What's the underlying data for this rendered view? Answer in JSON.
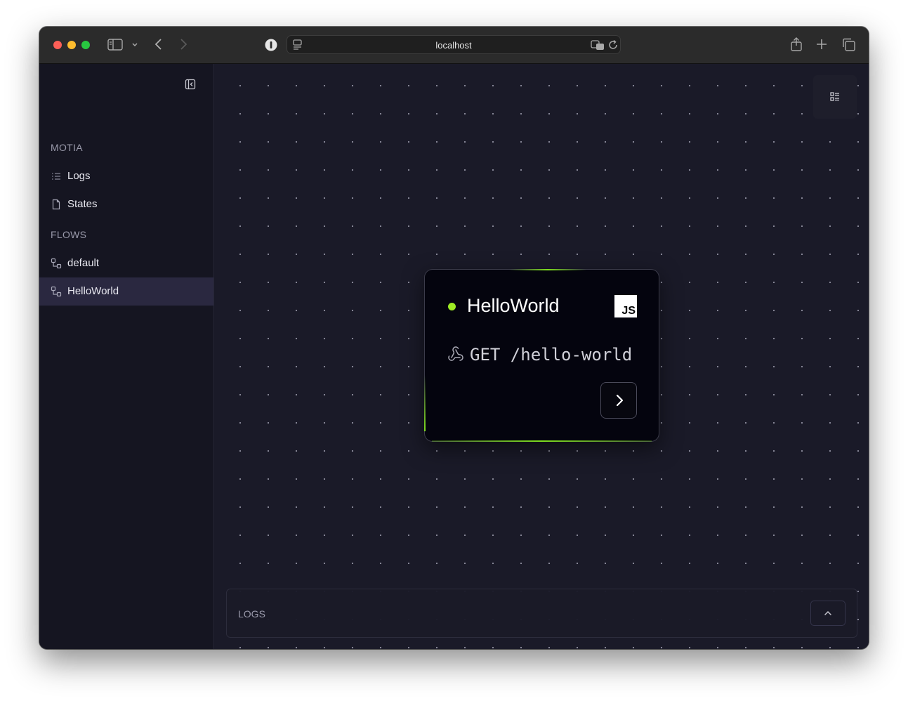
{
  "browser": {
    "url": "localhost"
  },
  "sidebar": {
    "sections": [
      {
        "title": "MOTIA",
        "items": [
          {
            "label": "Logs",
            "icon": "list-icon"
          },
          {
            "label": "States",
            "icon": "file-icon"
          }
        ]
      },
      {
        "title": "FLOWS",
        "items": [
          {
            "label": "default",
            "icon": "workflow-icon"
          },
          {
            "label": "HelloWorld",
            "icon": "workflow-icon",
            "active": true
          }
        ]
      }
    ]
  },
  "node": {
    "title": "HelloWorld",
    "language_badge": "JS",
    "method": "GET",
    "path": "/hello-world",
    "endpoint": "GET /hello-world",
    "status_color": "#9eeb24"
  },
  "logs_panel": {
    "title": "LOGS"
  },
  "colors": {
    "accent": "#7ddc1f",
    "background": "#1a1a28",
    "sidebar": "#151521",
    "active_item": "#2a2840"
  }
}
